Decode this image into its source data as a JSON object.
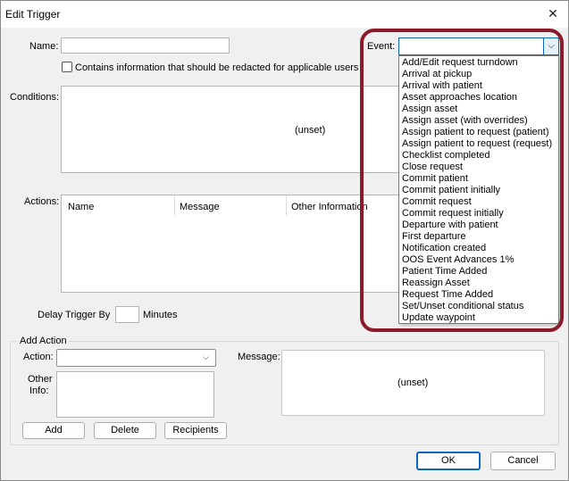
{
  "window": {
    "title": "Edit Trigger"
  },
  "form": {
    "name_label": "Name:",
    "name_value": "",
    "redact_label": "Contains information that should be redacted for applicable users",
    "redact_checked": false,
    "event_label": "Event:",
    "event_value": "",
    "conditions_label": "Conditions:",
    "conditions_value": "(unset)",
    "actions_label": "Actions:",
    "actions_columns": [
      "Name",
      "Message",
      "Other Information"
    ],
    "delay_label": "Delay Trigger By",
    "delay_value": "",
    "delay_unit": "Minutes"
  },
  "event_options": [
    "Add/Edit request turndown",
    "Arrival at pickup",
    "Arrival with patient",
    "Asset approaches location",
    "Assign asset",
    "Assign asset (with overrides)",
    "Assign patient to request (patient)",
    "Assign patient to request (request)",
    "Checklist completed",
    "Close request",
    "Commit patient",
    "Commit patient initially",
    "Commit request",
    "Commit request initially",
    "Departure with patient",
    "First departure",
    "Notification created",
    "OOS Event Advances 1%",
    "Patient Time Added",
    "Reassign Asset",
    "Request Time Added",
    "Set/Unset conditional status",
    "Update waypoint"
  ],
  "add_action": {
    "group_label": "Add Action",
    "action_label": "Action:",
    "action_value": "",
    "message_label": "Message:",
    "message_value": "(unset)",
    "other_info_label_1": "Other",
    "other_info_label_2": "Info:",
    "other_info_value": "",
    "add_button": "Add",
    "delete_button": "Delete",
    "recipients_button": "Recipients"
  },
  "footer": {
    "ok_button": "OK",
    "cancel_button": "Cancel"
  },
  "colors": {
    "highlight": "#8b1a2b",
    "focus": "#0a66c2"
  }
}
